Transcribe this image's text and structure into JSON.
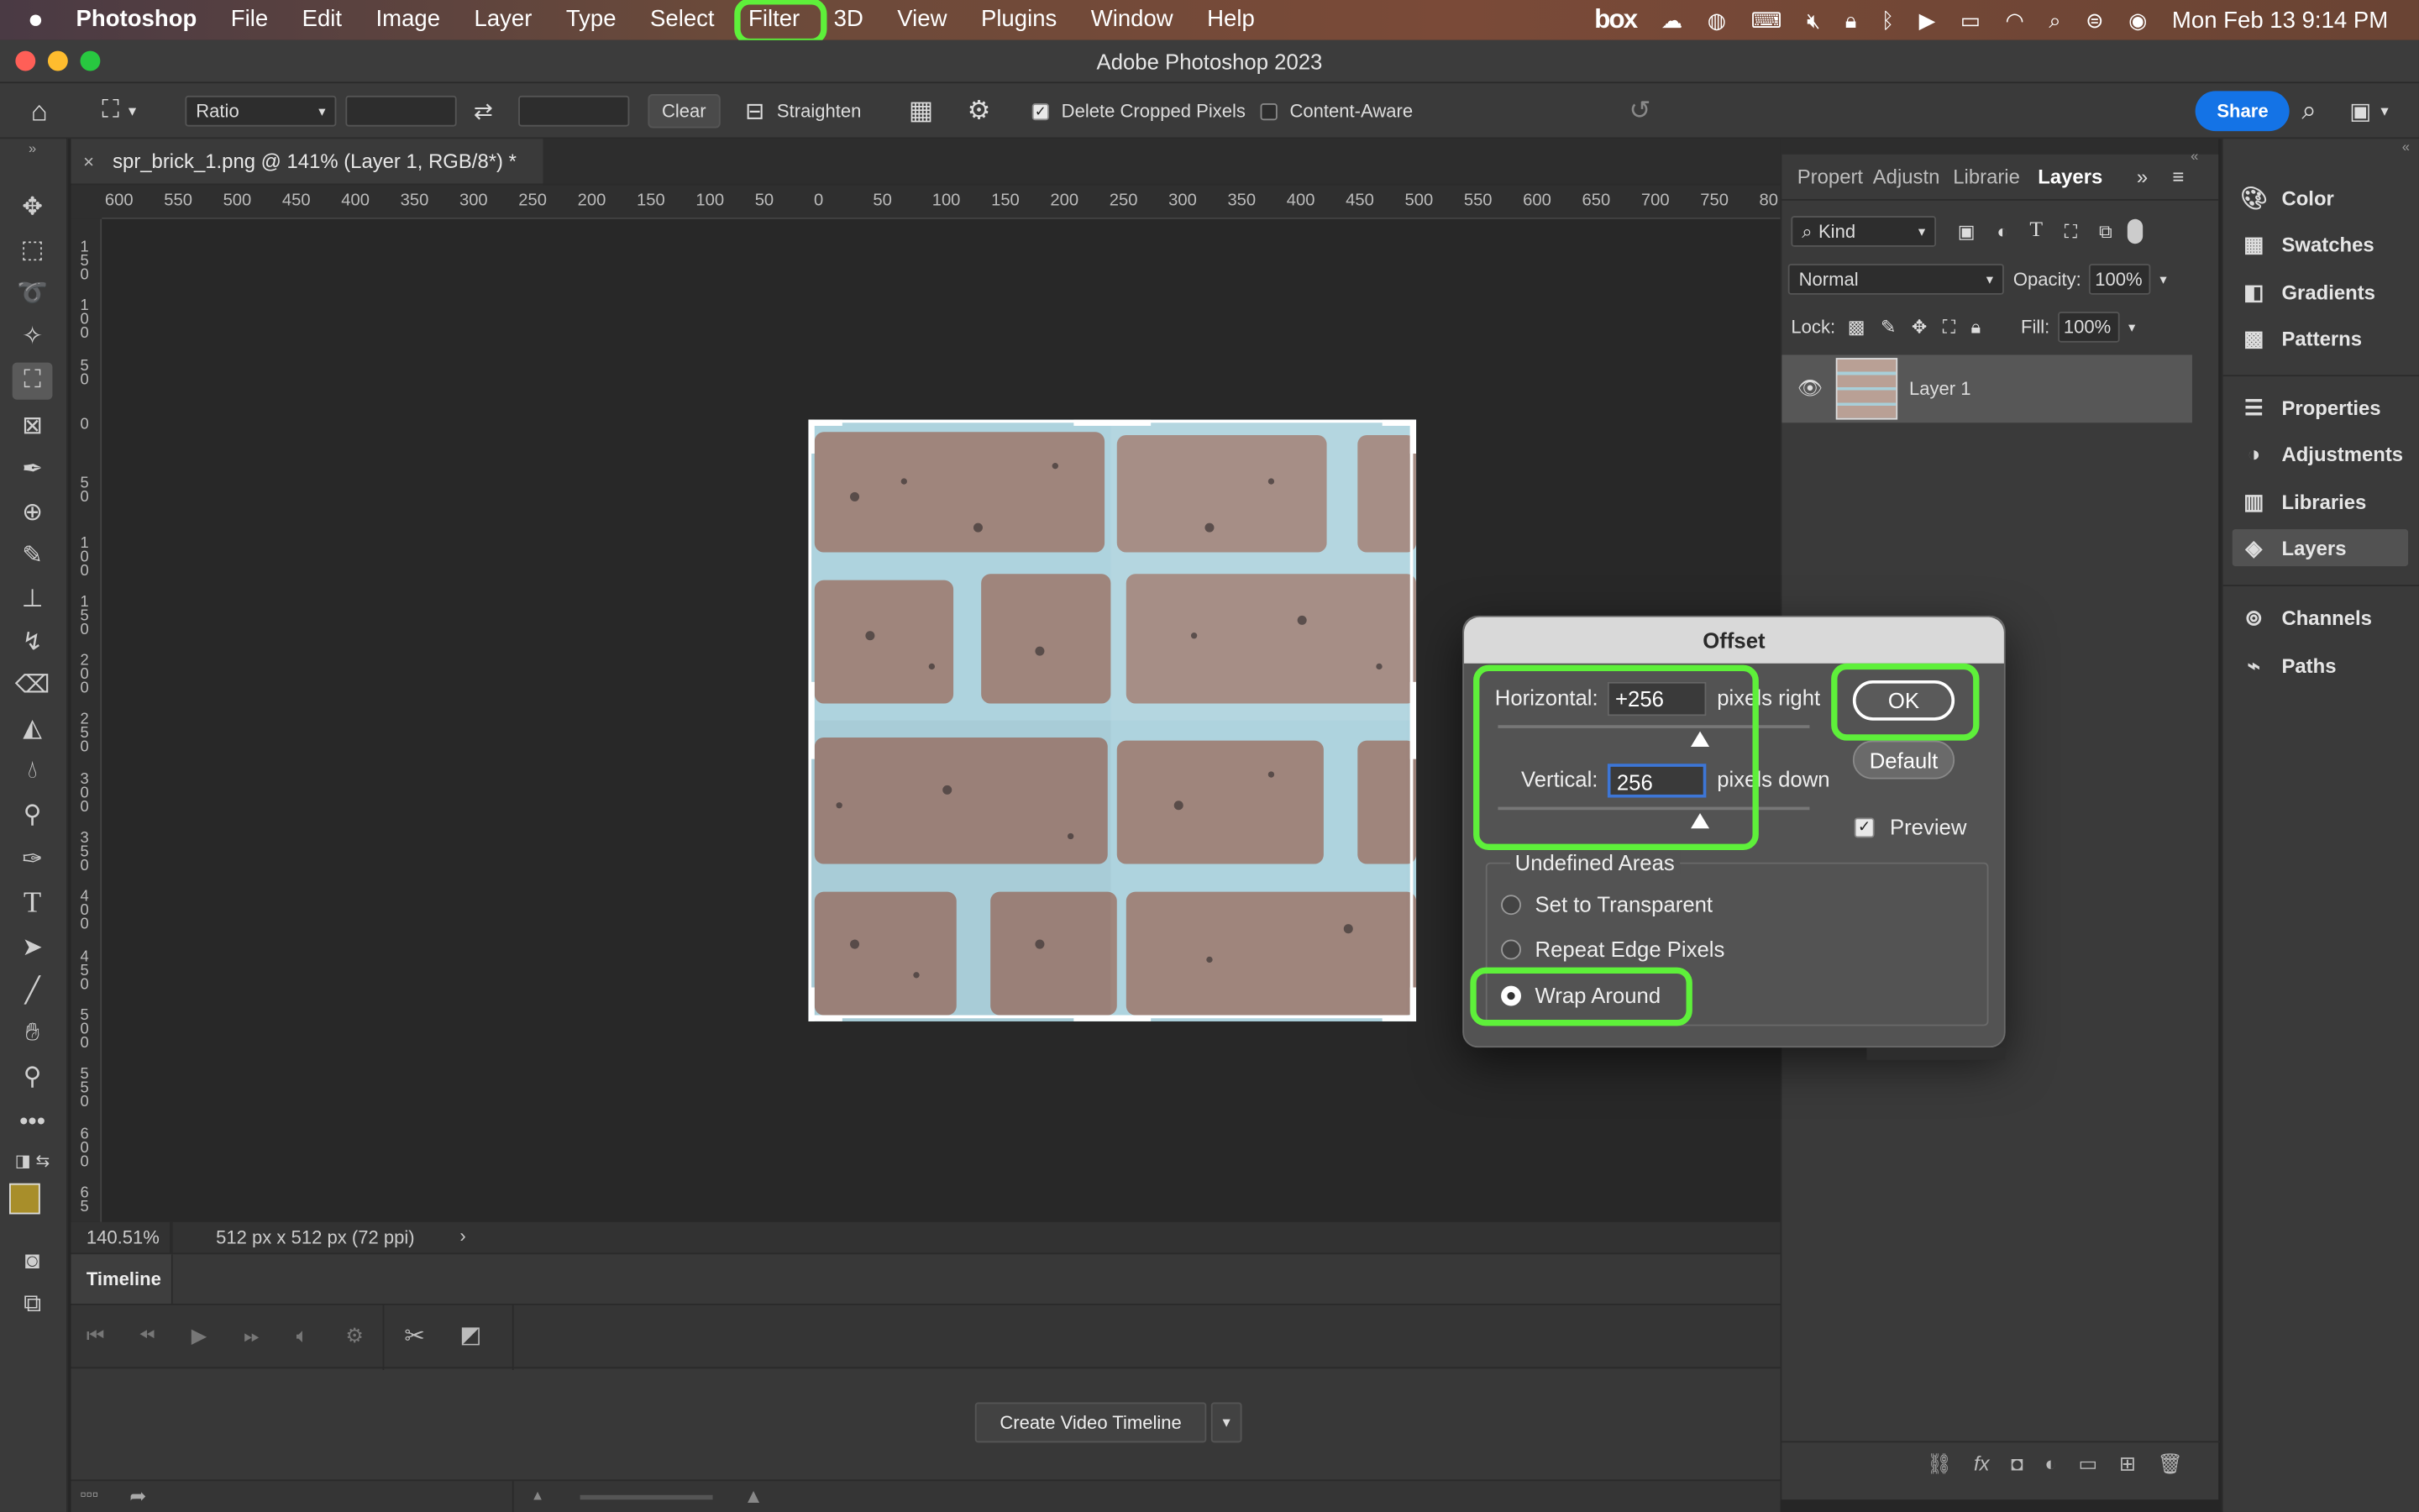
{
  "menubar": {
    "apple": "",
    "app": "Photoshop",
    "items": [
      "File",
      "Edit",
      "Image",
      "Layer",
      "Type",
      "Select",
      "Filter",
      "3D",
      "View",
      "Plugins",
      "Window",
      "Help"
    ],
    "box": "box",
    "clock": "Mon Feb 13  9:14 PM"
  },
  "window": {
    "title": "Adobe Photoshop 2023"
  },
  "options": {
    "ratio": "Ratio",
    "clear": "Clear",
    "straighten": "Straighten",
    "delete_cropped": "Delete Cropped Pixels",
    "delete_cropped_checked": true,
    "content_aware": "Content-Aware",
    "content_aware_checked": false,
    "share": "Share"
  },
  "document": {
    "tab": "spr_brick_1.png @ 141% (Layer 1, RGB/8*) *",
    "ruler_h": [
      "600",
      "550",
      "500",
      "450",
      "400",
      "350",
      "300",
      "250",
      "200",
      "150",
      "100",
      "50",
      "0",
      "50",
      "100",
      "150",
      "200",
      "250",
      "300",
      "350",
      "400",
      "450",
      "500",
      "550",
      "600",
      "650",
      "700",
      "750",
      "80"
    ],
    "ruler_v": [
      "1 5 0",
      "1 0 0",
      "5 0",
      "0",
      "5 0",
      "1 0 0",
      "1 5 0",
      "2 0 0",
      "2 5 0",
      "3 0 0",
      "3 5 0",
      "4 0 0",
      "4 5 0",
      "5 0 0",
      "5 5 0",
      "6 0 0",
      "6 5"
    ],
    "zoom": "140.51%",
    "size": "512 px x 512 px (72 ppi)"
  },
  "timeline": {
    "title": "Timeline",
    "create_button": "Create Video Timeline"
  },
  "layers_panel": {
    "tabs": [
      "Propert",
      "Adjustn",
      "Librarie",
      "Layers"
    ],
    "active_tab": "Layers",
    "kind": "Kind",
    "blend": "Normal",
    "opacity_label": "Opacity:",
    "opacity": "100%",
    "lock_label": "Lock:",
    "fill_label": "Fill:",
    "fill": "100%",
    "layer_name": "Layer 1"
  },
  "right_panel": {
    "group1": [
      "Color",
      "Swatches",
      "Gradients",
      "Patterns"
    ],
    "group2": [
      "Properties",
      "Adjustments",
      "Libraries",
      "Layers"
    ],
    "group3": [
      "Channels",
      "Paths"
    ],
    "active": "Layers"
  },
  "offset_dialog": {
    "title": "Offset",
    "horizontal_label": "Horizontal:",
    "horizontal_value": "+256",
    "horizontal_unit": "pixels right",
    "vertical_label": "Vertical:",
    "vertical_value": "256",
    "vertical_unit": "pixels down",
    "ok": "OK",
    "default": "Default",
    "preview": "Preview",
    "preview_checked": true,
    "undefined_areas": "Undefined Areas",
    "options": [
      "Set to Transparent",
      "Repeat Edge Pixels",
      "Wrap Around"
    ],
    "selected": "Wrap Around"
  },
  "colors": {
    "highlight": "#5ef03a",
    "foreground": "#a88e2a",
    "background": "#ffffff",
    "share": "#1473e6"
  }
}
